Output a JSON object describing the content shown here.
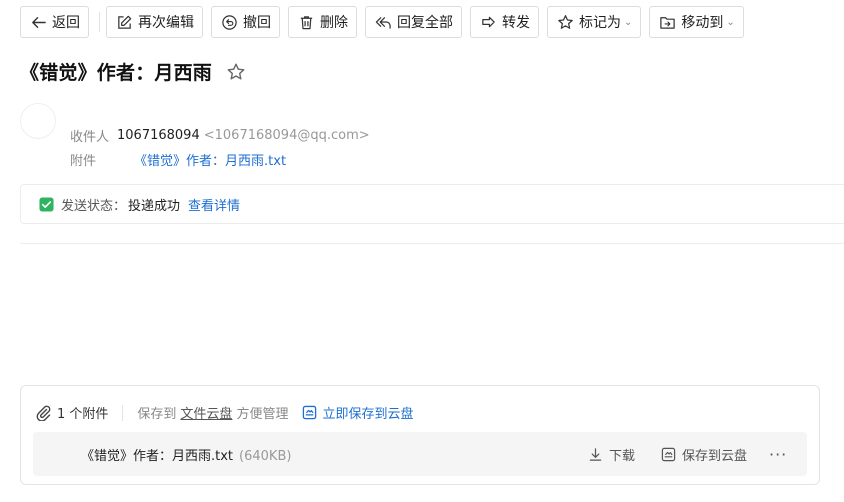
{
  "toolbar": {
    "back": "返回",
    "reedit": "再次编辑",
    "recall": "撤回",
    "delete": "删除",
    "reply_all": "回复全部",
    "forward": "转发",
    "mark_as": "标记为",
    "move_to": "移动到"
  },
  "subject": "《错觉》作者：月西雨",
  "header": {
    "recipient_label": "收件人",
    "recipient_name": "1067168094",
    "recipient_addr": "<1067168094@qq.com>",
    "attachment_label": "附件",
    "attachment_name": "《错觉》作者：月西雨.txt"
  },
  "status": {
    "label": "发送状态：",
    "value": "投递成功",
    "link": "查看详情"
  },
  "attachments": {
    "count": "1 个附件",
    "save_prefix": "保存到",
    "cloud_link": "文件云盘",
    "save_suffix": "方便管理",
    "save_now": "立即保存到云盘",
    "file": {
      "name": "《错觉》作者：月西雨.txt",
      "size": "(640KB)",
      "download": "下载",
      "save_cloud": "保存到云盘",
      "more": "···"
    }
  },
  "colors": {
    "link": "#1d6fd1",
    "success": "#2fb361"
  }
}
